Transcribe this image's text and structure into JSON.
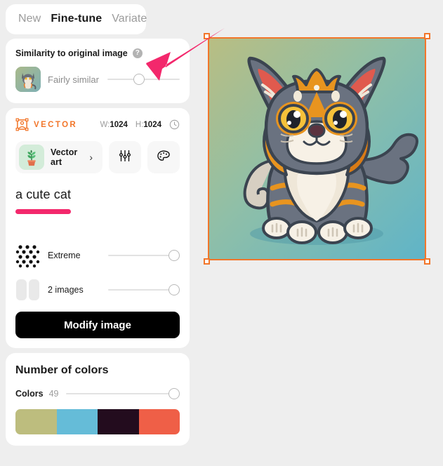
{
  "tabs": [
    {
      "label": "New",
      "active": false
    },
    {
      "label": "Fine-tune",
      "active": true
    },
    {
      "label": "Variate",
      "active": false
    }
  ],
  "similarity": {
    "title": "Similarity to original image",
    "help_icon": "help-circle-icon",
    "thumbnail_icon": "original-image-thumbnail",
    "value_label": "Fairly similar",
    "slider_percent": 50
  },
  "vector": {
    "logo_icon": "vector-nodes-icon",
    "logo_label": "VECTOR",
    "width_key": "W:",
    "width_value": "1024",
    "height_key": "H:",
    "height_value": "1024",
    "history_icon": "clock-icon",
    "style": {
      "thumb_icon": "potted-plant-icon",
      "name": "Vector art",
      "chevron_icon": "chevron-right-icon"
    },
    "settings_icon": "sliders-icon",
    "palette_icon": "color-palette-icon",
    "prompt": "a cute cat",
    "options": [
      {
        "icon": "polka-dots-icon",
        "label": "Extreme",
        "slider_percent": 100
      },
      {
        "icon": "two-panels-icon",
        "label": "2 images",
        "slider_percent": 100
      }
    ],
    "modify_label": "Modify image"
  },
  "colors": {
    "title": "Number of colors",
    "label": "Colors",
    "value": "49",
    "slider_percent": 100,
    "swatches": [
      "#bdbd7e",
      "#65bcd8",
      "#230c1e",
      "#ef5f47"
    ]
  },
  "canvas": {
    "selection_color": "#f2762a",
    "image_name": "cute-cat-vector-art",
    "handles": [
      "top-left",
      "top-right",
      "bottom-left",
      "bottom-right"
    ]
  },
  "annotation": {
    "arrow_icon": "pink-pointer-arrow",
    "arrow_color": "#f3286c"
  }
}
